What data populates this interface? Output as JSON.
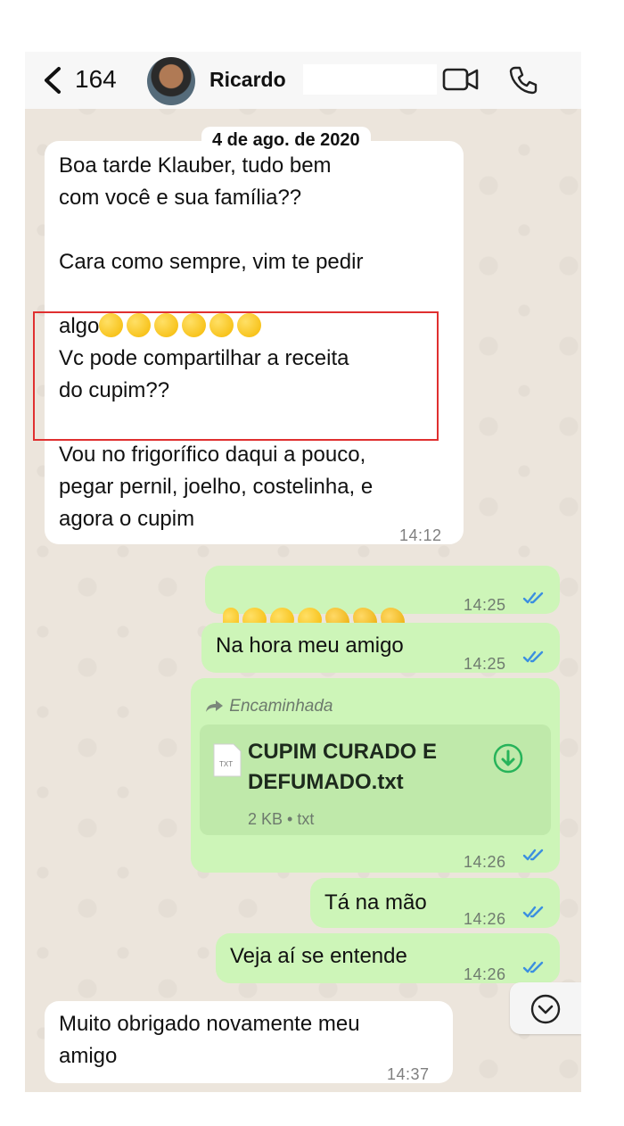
{
  "header": {
    "back_count": "164",
    "contact_name": "Ricardo",
    "icons": [
      "chevron-left-icon",
      "avatar",
      "video-call-icon",
      "phone-call-icon"
    ]
  },
  "date_chip": "4 de ago. de 2020",
  "messages": [
    {
      "dir": "in",
      "text": "Boa tarde Klauber, tudo bem\ncom você e sua família??",
      "text2": "Cara como sempre, vim te pedir",
      "text3": "algo",
      "text4": "Vc pode compartilhar a receita\ndo cupim??",
      "text5": "Vou no frigorífico daqui a pouco,\npegar pernil, joelho, costelinha, e\nagora o cupim",
      "time": "14:12"
    },
    {
      "dir": "out",
      "text": "☝😁😁😁👏👏👏",
      "time": "14:25",
      "read": true
    },
    {
      "dir": "out",
      "text": "Na hora meu amigo",
      "time": "14:25",
      "read": true
    },
    {
      "dir": "out",
      "forwarded_label": "Encaminhada",
      "file": {
        "name": "CUPIM CURADO E DEFUMADO.txt",
        "meta": "2 KB • txt",
        "icon_label": "TXT"
      },
      "time": "14:26",
      "read": true
    },
    {
      "dir": "out",
      "text": "Tá na mão",
      "time": "14:26",
      "read": true
    },
    {
      "dir": "out",
      "text": "Veja aí se entende",
      "time": "14:26",
      "read": true
    },
    {
      "dir": "in",
      "text": "Muito obrigado novamente meu\namigo",
      "time": "14:37"
    }
  ],
  "colors": {
    "chat_bg": "#ece5dc",
    "outgoing_bubble": "#cdf5b8",
    "incoming_bubble": "#ffffff",
    "read_ticks": "#3b8fe0",
    "highlight": "#e03030"
  }
}
